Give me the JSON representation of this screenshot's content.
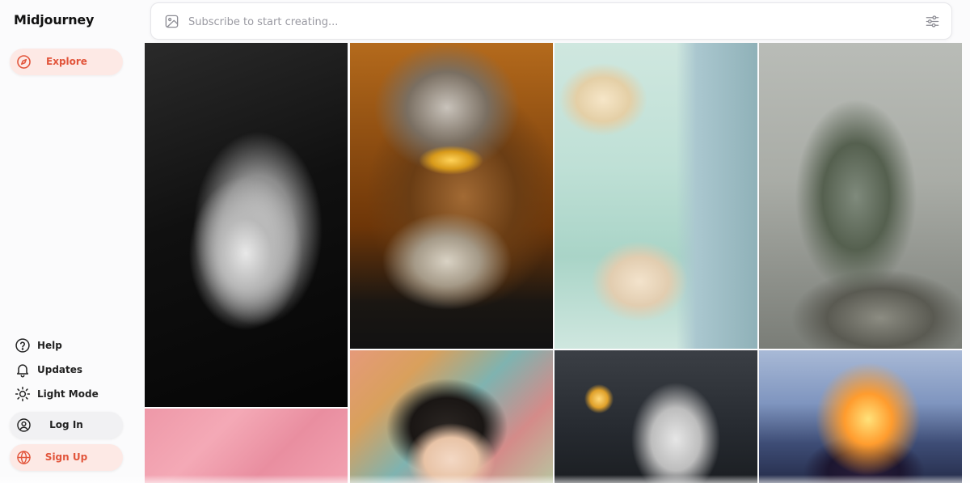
{
  "app": {
    "brand": "Midjourney"
  },
  "sidebar": {
    "explore_label": "Explore",
    "help_label": "Help",
    "updates_label": "Updates",
    "light_mode_label": "Light Mode",
    "login_label": "Log In",
    "signup_label": "Sign Up"
  },
  "search": {
    "placeholder": "Subscribe to start creating..."
  },
  "gallery": {
    "items": [
      {
        "image": "black-and-white-woman-portrait"
      },
      {
        "image": "bearded-man-gold-glasses"
      },
      {
        "image": "mint-green-loft-interior"
      },
      {
        "image": "stone-head-cliff"
      },
      {
        "image": "pink-texture"
      },
      {
        "image": "illustrated-sleeping-girl"
      },
      {
        "image": "robot-with-staff"
      },
      {
        "image": "fire-head-illustration"
      }
    ]
  },
  "colors": {
    "accent": "#e2553b",
    "accent_bg": "#fde9e5",
    "neutral_button_bg": "#f1f1f3",
    "page_bg": "#fbfbfc"
  },
  "icons": {
    "explore": "compass-icon",
    "help": "question-circle-icon",
    "updates": "bell-icon",
    "light_mode": "sun-icon",
    "login": "user-circle-icon",
    "signup": "globe-icon",
    "search_image": "image-icon",
    "search_filter": "sliders-icon"
  }
}
